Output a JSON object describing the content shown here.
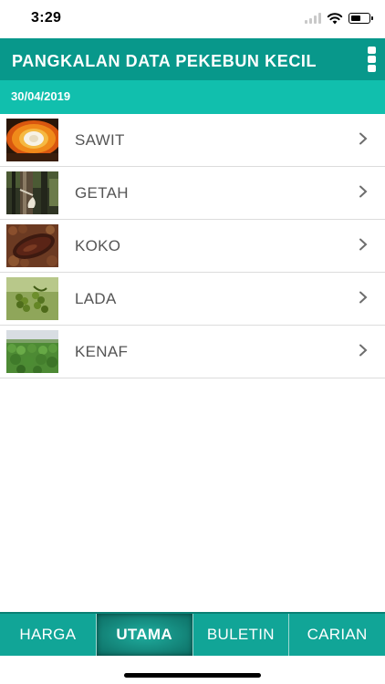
{
  "status_bar": {
    "time": "3:29",
    "battery_level": 0.55
  },
  "header": {
    "title": "PANGKALAN DATA PEKEBUN KECIL",
    "menu_icon": "vertical-dots-icon",
    "date": "30/04/2019"
  },
  "crops": [
    {
      "label": "SAWIT",
      "image": "oil-palm-fruit"
    },
    {
      "label": "GETAH",
      "image": "rubber-tapping"
    },
    {
      "label": "KOKO",
      "image": "cocoa-pod"
    },
    {
      "label": "LADA",
      "image": "pepper-berries"
    },
    {
      "label": "KENAF",
      "image": "kenaf-field"
    }
  ],
  "tabs": [
    {
      "label": "HARGA",
      "active": false
    },
    {
      "label": "UTAMA",
      "active": true
    },
    {
      "label": "BULETIN",
      "active": false
    },
    {
      "label": "CARIAN",
      "active": false
    }
  ],
  "colors": {
    "header": "#08988b",
    "date_bar": "#11bfad",
    "tab_bar": "#11a597"
  }
}
